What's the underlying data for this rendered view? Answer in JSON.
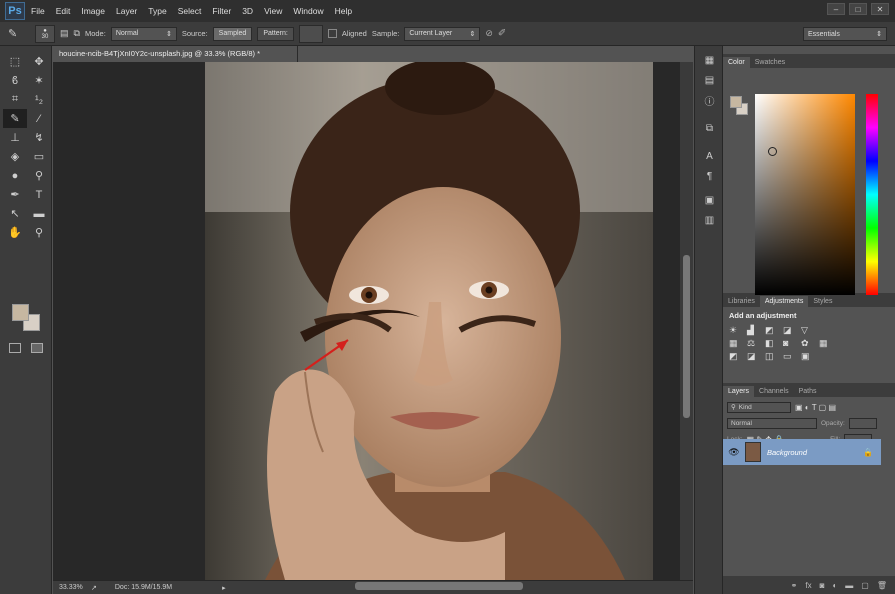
{
  "menubar": {
    "logo": "Ps",
    "items": [
      "File",
      "Edit",
      "Image",
      "Layer",
      "Type",
      "Select",
      "Filter",
      "3D",
      "View",
      "Window",
      "Help"
    ]
  },
  "options": {
    "brush_size": "30",
    "mode_label": "Mode:",
    "mode_value": "Normal",
    "source_label": "Source:",
    "sampled": "Sampled",
    "pattern": "Pattern:",
    "aligned": "Aligned",
    "sample_label": "Sample:",
    "sample_value": "Current Layer",
    "workspace": "Essentials"
  },
  "document": {
    "tab_title": "houcine-ncib-B4TjXnI0Y2c-unsplash.jpg @ 33.3% (RGB/8) *"
  },
  "status": {
    "zoom": "33.33%",
    "doc": "Doc: 15.9M/15.9M"
  },
  "color_panel": {
    "tabs": [
      "Color",
      "Swatches"
    ],
    "fg": "#c6b7a1",
    "bg": "#d8d0c6"
  },
  "adjust_panel": {
    "tabs": [
      "Libraries",
      "Adjustments",
      "Styles"
    ],
    "title": "Add an adjustment"
  },
  "layers_panel": {
    "tabs": [
      "Layers",
      "Channels",
      "Paths"
    ],
    "kind": "Kind",
    "blend": "Normal",
    "opacity_label": "Opacity:",
    "lock_label": "Lock:",
    "fill_label": "Fill:",
    "layer_name": "Background"
  }
}
